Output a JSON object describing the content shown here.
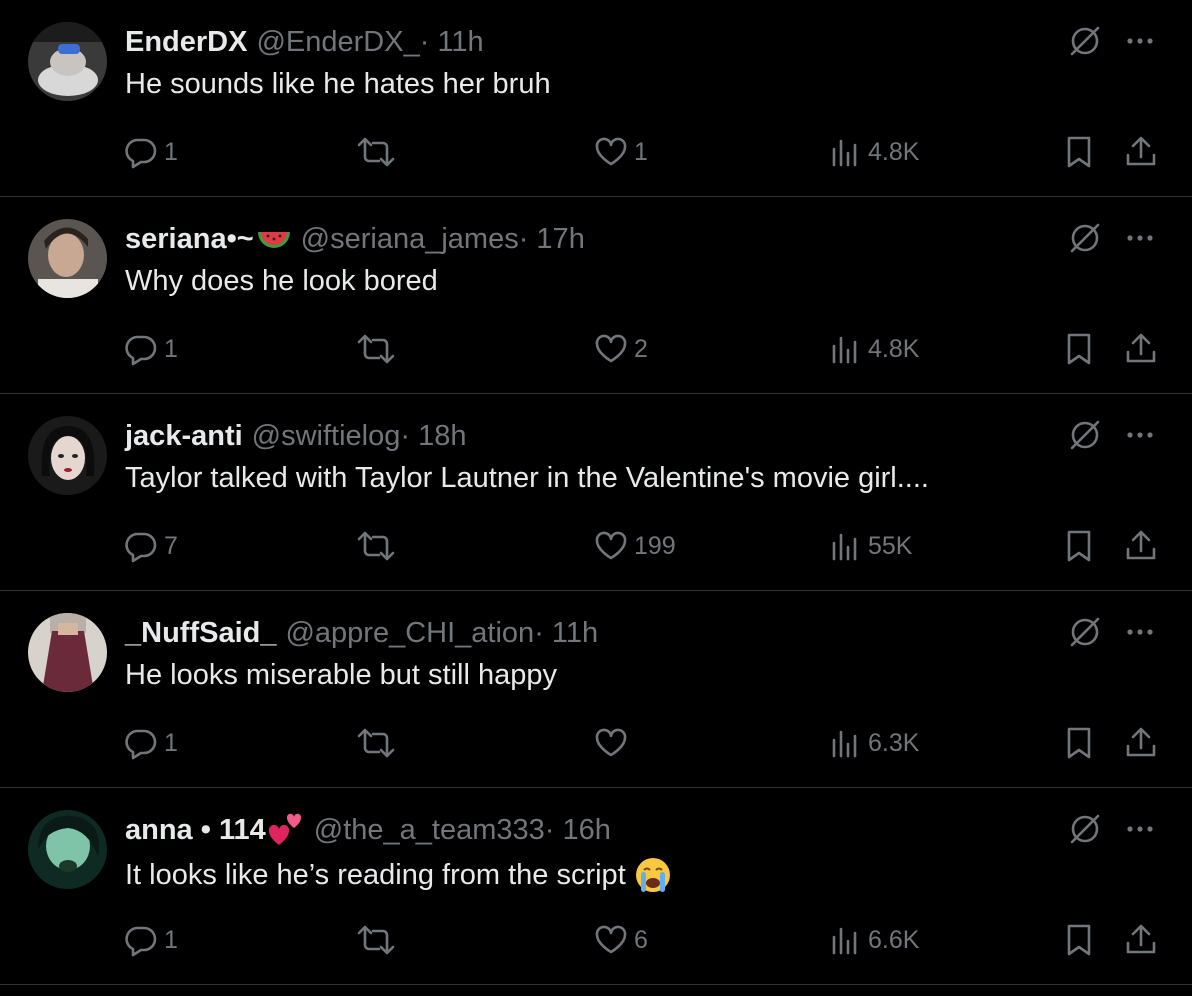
{
  "colors": {
    "background": "#000000",
    "text": "#e7e9ea",
    "muted": "#71767b",
    "divider": "#2f3336"
  },
  "posts": [
    {
      "name": "EnderDX",
      "handle": "@EnderDX_",
      "time": " · 11h",
      "text": "He sounds like he hates her bruh",
      "replies": "1",
      "retweets": "",
      "likes": "1",
      "views": "4.8K"
    },
    {
      "name": "seriana•~",
      "name_emoji": "watermelon",
      "handle": "@seriana_james",
      "time": " · 17h",
      "text": "Why does he look bored",
      "replies": "1",
      "retweets": "",
      "likes": "2",
      "views": "4.8K"
    },
    {
      "name": "jack-anti",
      "handle": "@swiftielog",
      "time": " · 18h",
      "text": "Taylor talked with Taylor Lautner in the Valentine's movie girl....",
      "replies": "7",
      "retweets": "",
      "likes": "199",
      "views": "55K"
    },
    {
      "name": "_NuffSaid_",
      "handle": "@appre_CHI_ation",
      "time": " · 11h",
      "text": "He looks miserable but still happy",
      "replies": "1",
      "retweets": "",
      "likes": "",
      "views": "6.3K"
    },
    {
      "name": "anna • 114",
      "name_emoji": "two-hearts",
      "handle": "@the_a_team333",
      "time": " · 16h",
      "text": "It looks like he’s reading from the script",
      "text_emoji": "loudly-crying-face",
      "replies": "1",
      "retweets": "",
      "likes": "6",
      "views": "6.6K"
    }
  ]
}
